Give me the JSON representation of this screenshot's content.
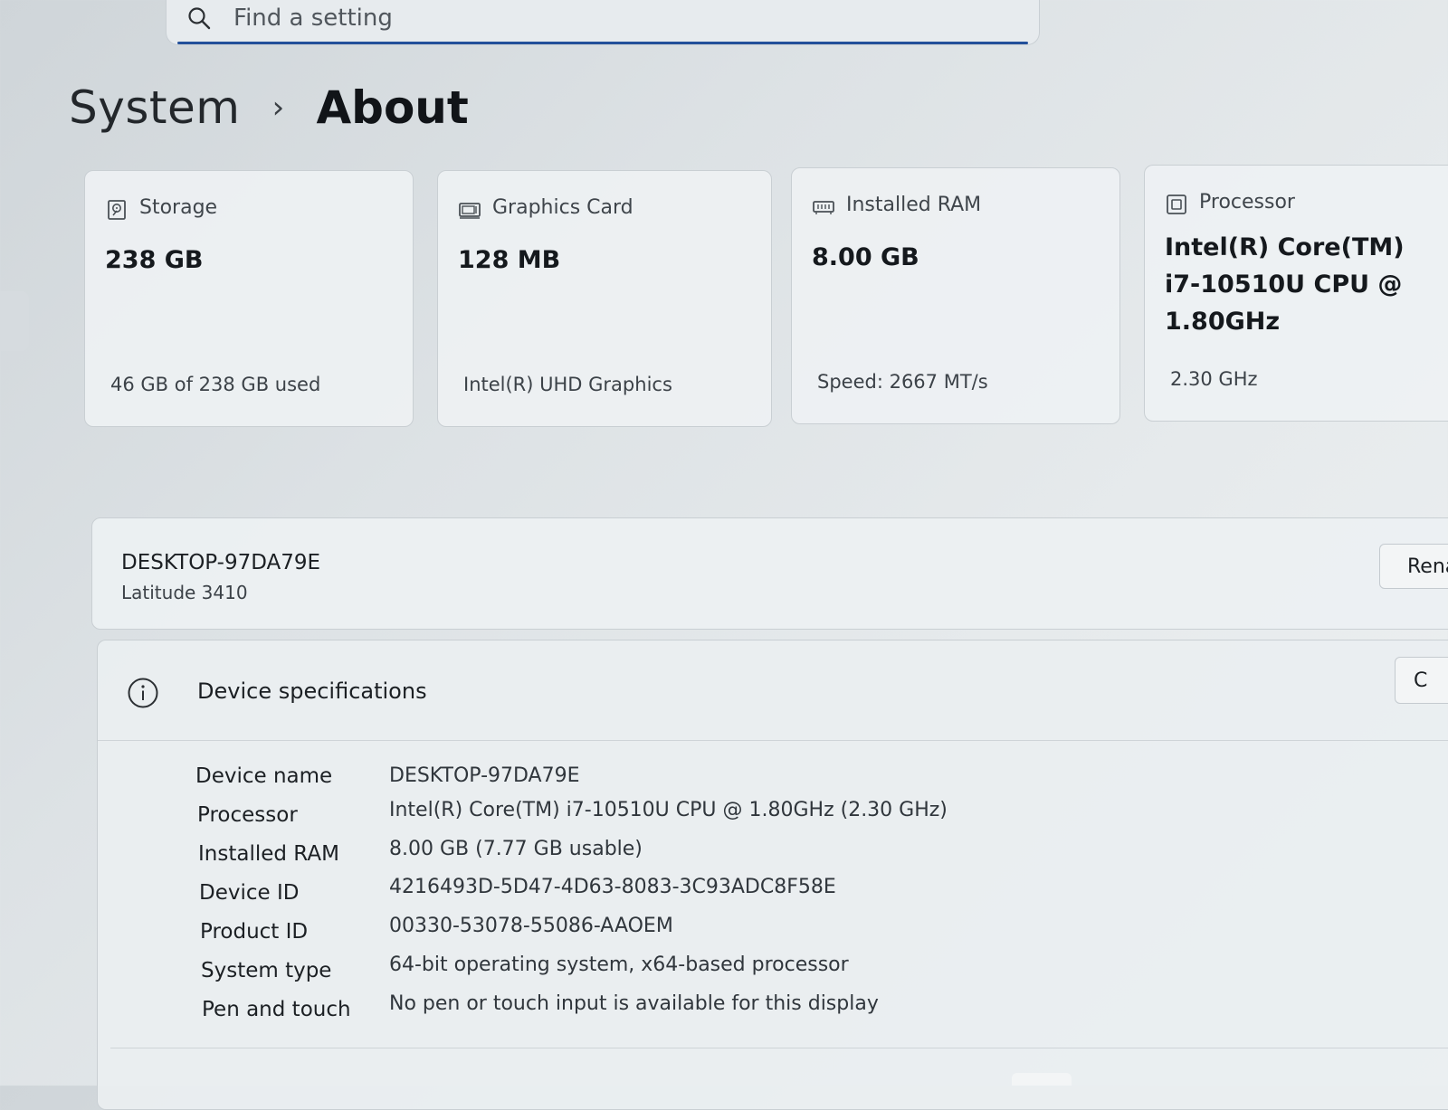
{
  "search": {
    "placeholder": "Find a setting"
  },
  "breadcrumb": {
    "parent": "System",
    "separator": "›",
    "current": "About"
  },
  "cards": [
    {
      "icon": "storage-icon",
      "label": "Storage",
      "value": "238 GB",
      "sub": "46 GB of 238 GB used"
    },
    {
      "icon": "graphics-card-icon",
      "label": "Graphics Card",
      "value": "128 MB",
      "sub": "Intel(R) UHD Graphics"
    },
    {
      "icon": "ram-icon",
      "label": "Installed RAM",
      "value": "8.00 GB",
      "sub": "Speed: 2667 MT/s"
    },
    {
      "icon": "processor-icon",
      "label": "Processor",
      "value_lines": [
        "Intel(R) Core(TM)",
        "i7-10510U CPU @",
        "1.80GHz"
      ],
      "sub": "2.30 GHz"
    }
  ],
  "device": {
    "name": "DESKTOP-97DA79E",
    "model": "Latitude 3410",
    "rename_label": "Rena"
  },
  "specs": {
    "title": "Device specifications",
    "copy_label": "C",
    "rows": [
      {
        "label": "Device name",
        "value": "DESKTOP-97DA79E"
      },
      {
        "label": "Processor",
        "value": "Intel(R) Core(TM) i7-10510U CPU @ 1.80GHz (2.30 GHz)"
      },
      {
        "label": "Installed RAM",
        "value": "8.00 GB (7.77 GB usable)"
      },
      {
        "label": "Device ID",
        "value": "4216493D-5D47-4D63-8083-3C93ADC8F58E"
      },
      {
        "label": "Product ID",
        "value": "00330-53078-55086-AAOEM"
      },
      {
        "label": "System type",
        "value": "64-bit operating system, x64-based processor"
      },
      {
        "label": "Pen and touch",
        "value": "No pen or touch input is available for this display"
      }
    ]
  },
  "colors": {
    "accent": "#23509a",
    "background": "#e3e7ea",
    "card": "#eef1f3",
    "border": "#c9cfd3"
  }
}
